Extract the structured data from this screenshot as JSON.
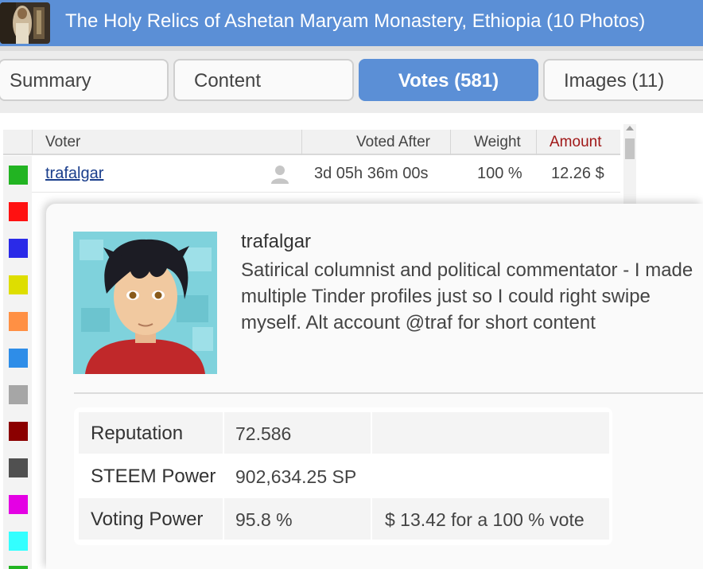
{
  "header": {
    "title": "The Holy Relics of Ashetan Maryam Monastery, Ethiopia (10 Photos)"
  },
  "tabs": [
    {
      "label": "Summary"
    },
    {
      "label": "Content"
    },
    {
      "label": "Votes (581)"
    },
    {
      "label": "Images (11)"
    }
  ],
  "table": {
    "headers": {
      "voter": "Voter",
      "voted_after": "Voted After",
      "weight": "Weight",
      "amount": "Amount"
    },
    "row1": {
      "voter": "trafalgar",
      "voted_after": "3d 05h 36m 00s",
      "weight": "100 %",
      "amount": "12.26 $"
    },
    "swatch_colors": [
      "#22b422",
      "#ff1111",
      "#2a2ae8",
      "#dede00",
      "#ff9044",
      "#2e8de8",
      "#a6a6a6",
      "#8b0000",
      "#505050",
      "#e400e4",
      "#33ffff",
      "#22b422"
    ]
  },
  "profile": {
    "name": "trafalgar",
    "bio": "Satirical columnist and political commentator - I made multiple Tinder profiles just so I could right swipe myself. Alt account @traf for short content"
  },
  "stats": {
    "reputation_label": "Reputation",
    "reputation_value": "72.586",
    "sp_label": "STEEM Power",
    "sp_value": "902,634.25 SP",
    "vp_label": "Voting Power",
    "vp_value": "95.8 %",
    "vote_value": "$ 13.42 for a 100 % vote"
  },
  "colors": {
    "accent": "#5b8fd6",
    "amount_header": "#a01818"
  }
}
